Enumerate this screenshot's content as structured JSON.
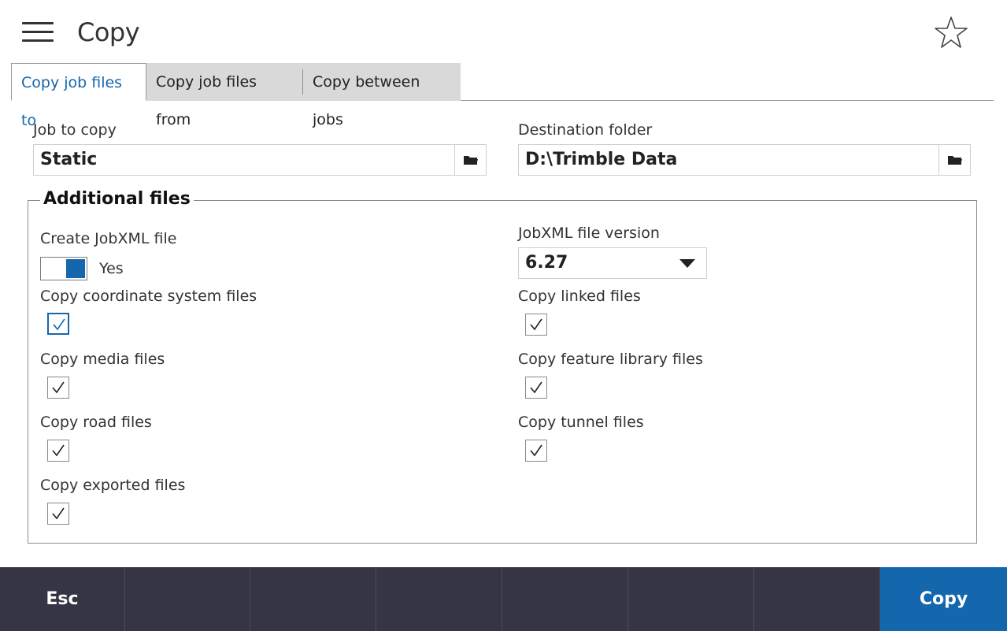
{
  "header": {
    "title": "Copy",
    "menu_icon": "hamburger-menu-icon",
    "favorite_icon": "star-icon"
  },
  "tabs": [
    {
      "label": "Copy job files to",
      "active": true
    },
    {
      "label": "Copy job files from",
      "active": false
    },
    {
      "label": "Copy between jobs",
      "active": false
    }
  ],
  "job": {
    "label": "Job to copy",
    "value": "Static"
  },
  "destination": {
    "label": "Destination folder",
    "value": "D:\\Trimble Data"
  },
  "additional": {
    "title": "Additional files",
    "create_jobxml": {
      "label": "Create JobXML file",
      "state": "Yes"
    },
    "jobxml_version": {
      "label": "JobXML file version",
      "value": "6.27"
    },
    "options": {
      "coordinate": {
        "label": "Copy coordinate system files",
        "checked": true
      },
      "media": {
        "label": "Copy media files",
        "checked": true
      },
      "road": {
        "label": "Copy road files",
        "checked": true
      },
      "exported": {
        "label": "Copy exported files",
        "checked": true
      },
      "linked": {
        "label": "Copy linked files",
        "checked": true
      },
      "feature_library": {
        "label": "Copy feature library files",
        "checked": true
      },
      "tunnel": {
        "label": "Copy tunnel files",
        "checked": true
      }
    }
  },
  "footer": {
    "esc_label": "Esc",
    "copy_label": "Copy"
  },
  "colors": {
    "accent": "#1567ad",
    "footer_bg": "#363545",
    "tab_inactive_bg": "#d9d9d9"
  }
}
